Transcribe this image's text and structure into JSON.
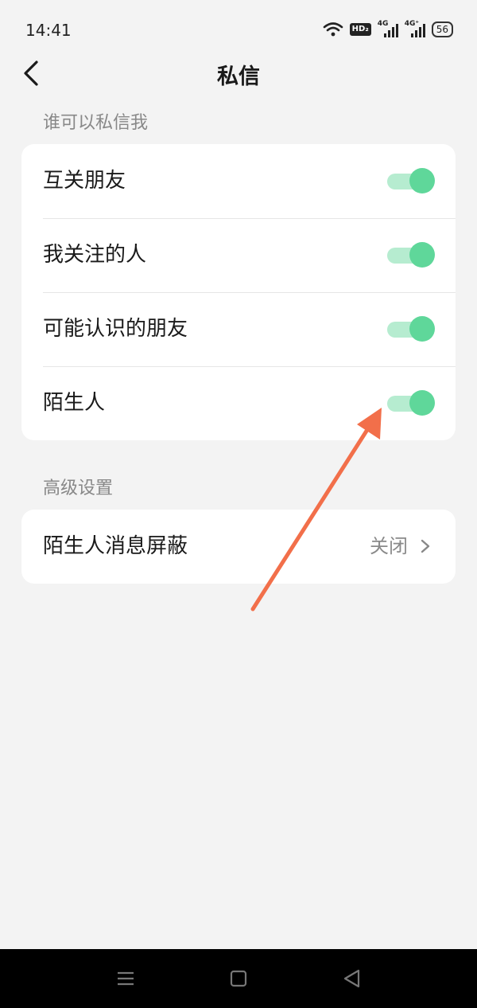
{
  "status_bar": {
    "time": "14:41",
    "hd_label": "HD₂",
    "signal1_label": "4G",
    "signal2_label": "4G⁺",
    "battery": "56"
  },
  "header": {
    "title": "私信",
    "back_icon": "chevron-left-icon"
  },
  "who_can_message": {
    "section_title": "谁可以私信我",
    "items": [
      {
        "label": "互关朋友",
        "enabled": true
      },
      {
        "label": "我关注的人",
        "enabled": true
      },
      {
        "label": "可能认识的朋友",
        "enabled": true
      },
      {
        "label": "陌生人",
        "enabled": true
      }
    ]
  },
  "advanced": {
    "section_title": "高级设置",
    "items": [
      {
        "label": "陌生人消息屏蔽",
        "value": "关闭",
        "icon": "chevron-right-icon"
      }
    ]
  },
  "colors": {
    "toggle_knob": "#5fd79a",
    "toggle_track": "#b6ecd0",
    "annotation_arrow": "#f26f4a",
    "background": "#f3f3f3"
  }
}
